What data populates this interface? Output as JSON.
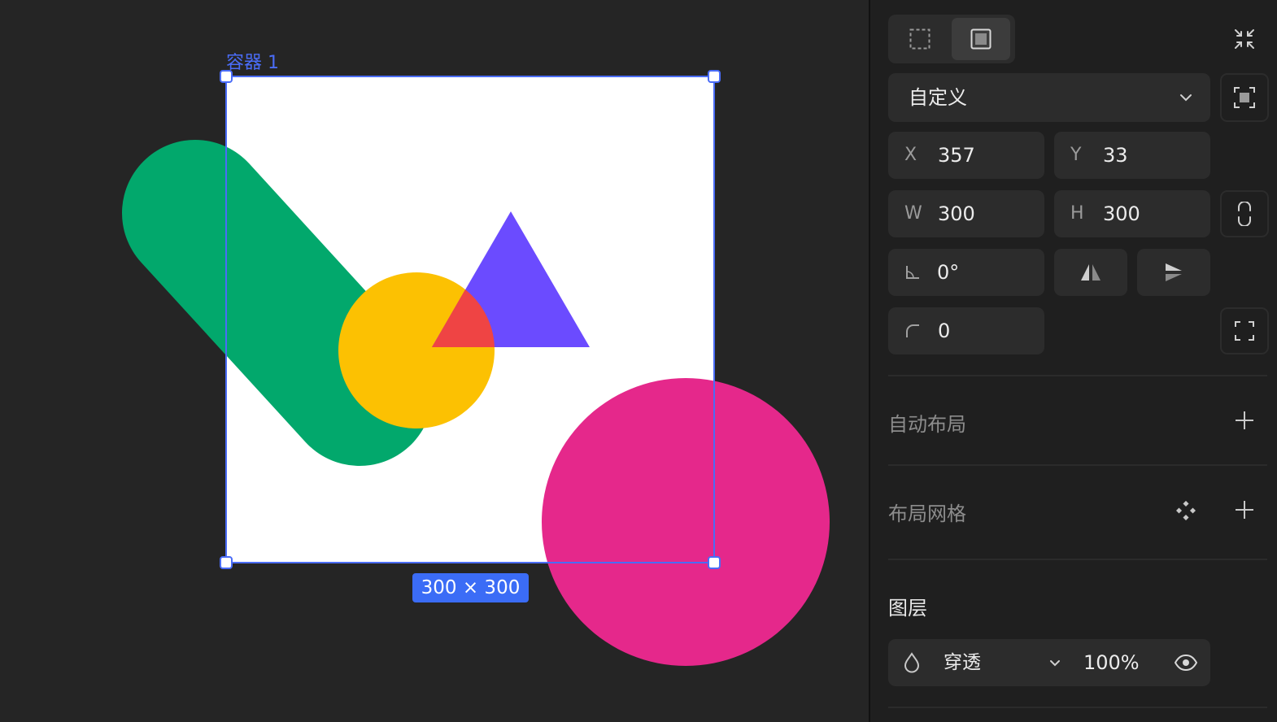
{
  "canvas": {
    "frame_label": "容器 1",
    "size_badge": "300 × 300",
    "colors": {
      "background": "#252525",
      "frame_fill": "#ffffff",
      "selection": "#4a6cf7",
      "green": "#02a86c",
      "yellow": "#fcc102",
      "purple": "#6b4bff",
      "red": "#ef4444",
      "pink": "#e5288b"
    }
  },
  "panel": {
    "preset": {
      "value": "自定义"
    },
    "fields": {
      "x": {
        "label": "X",
        "value": "357"
      },
      "y": {
        "label": "Y",
        "value": "33"
      },
      "w": {
        "label": "W",
        "value": "300"
      },
      "h": {
        "label": "H",
        "value": "300"
      },
      "rotation": {
        "value": "0°"
      },
      "radius": {
        "value": "0"
      }
    },
    "sections": {
      "auto_layout": "自动布局",
      "layout_grid": "布局网格",
      "layer": "图层"
    },
    "layer": {
      "blend_mode": "穿透",
      "opacity": "100%"
    }
  }
}
